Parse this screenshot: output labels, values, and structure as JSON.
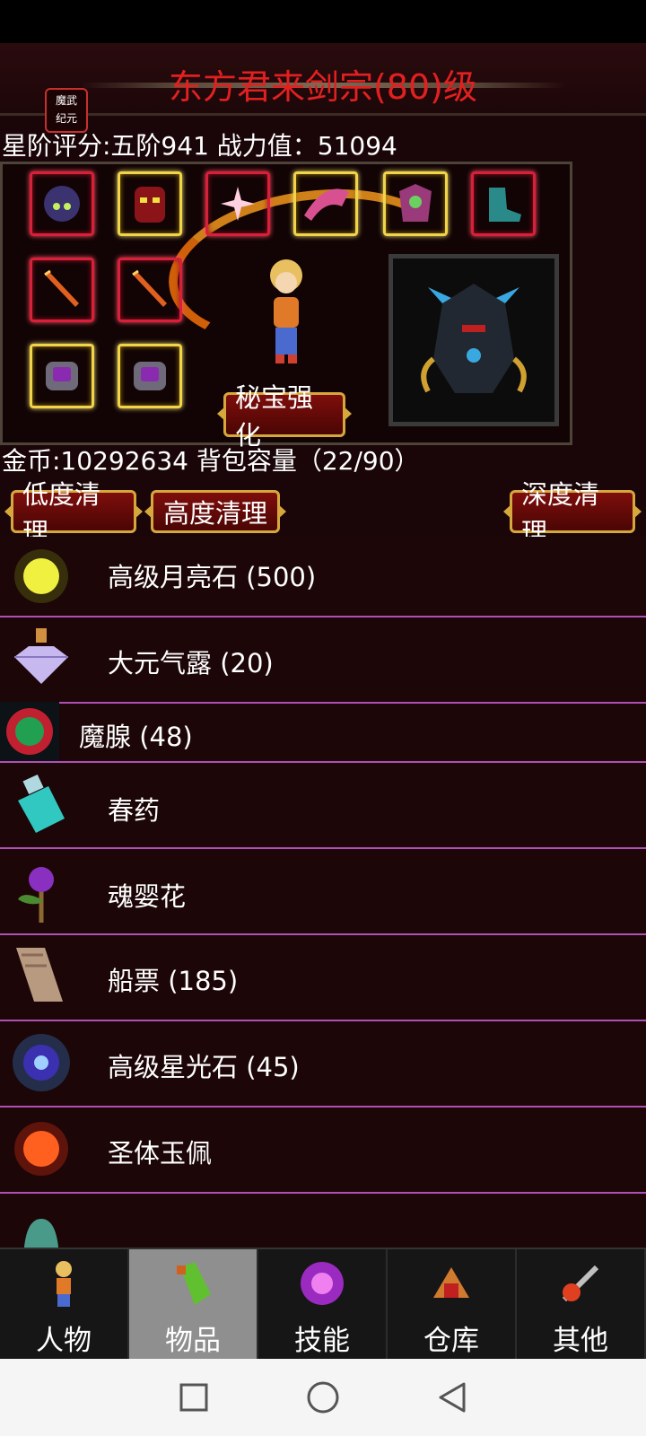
{
  "title": "东方君来剑宗(80)级",
  "logo_text": "魔武纪元",
  "stats": "星阶评分:五阶941 战力值：51094",
  "equip_button": "秘宝强化",
  "bag_info": "金币:10292634 背包容量（22/90）",
  "clean_buttons": {
    "low": "低度清理",
    "high": "高度清理",
    "deep": "深度清理"
  },
  "items": [
    {
      "label": "高级月亮石 (500)",
      "icon": "moonstone-icon"
    },
    {
      "label": "大元气露 (20)",
      "icon": "crystal-potion-icon"
    },
    {
      "label": "魔腺 (48)",
      "icon": "demon-gland-icon"
    },
    {
      "label": "春药",
      "icon": "potion-bottle-icon"
    },
    {
      "label": "魂婴花",
      "icon": "soul-flower-icon"
    },
    {
      "label": "船票 (185)",
      "icon": "ticket-scroll-icon"
    },
    {
      "label": "高级星光石 (45)",
      "icon": "starlight-stone-icon"
    },
    {
      "label": "圣体玉佩",
      "icon": "jade-pendant-icon"
    }
  ],
  "tabs": [
    {
      "label": "人物",
      "icon": "character-icon"
    },
    {
      "label": "物品",
      "icon": "items-icon",
      "active": true
    },
    {
      "label": "技能",
      "icon": "skills-icon"
    },
    {
      "label": "仓库",
      "icon": "warehouse-icon"
    },
    {
      "label": "其他",
      "icon": "other-icon"
    }
  ],
  "colors": {
    "title": "#e22020",
    "divider": "#b04fb5",
    "slot_red": "#d8203a",
    "slot_gold": "#f1d44a",
    "button_gold": "#d6a83c"
  }
}
